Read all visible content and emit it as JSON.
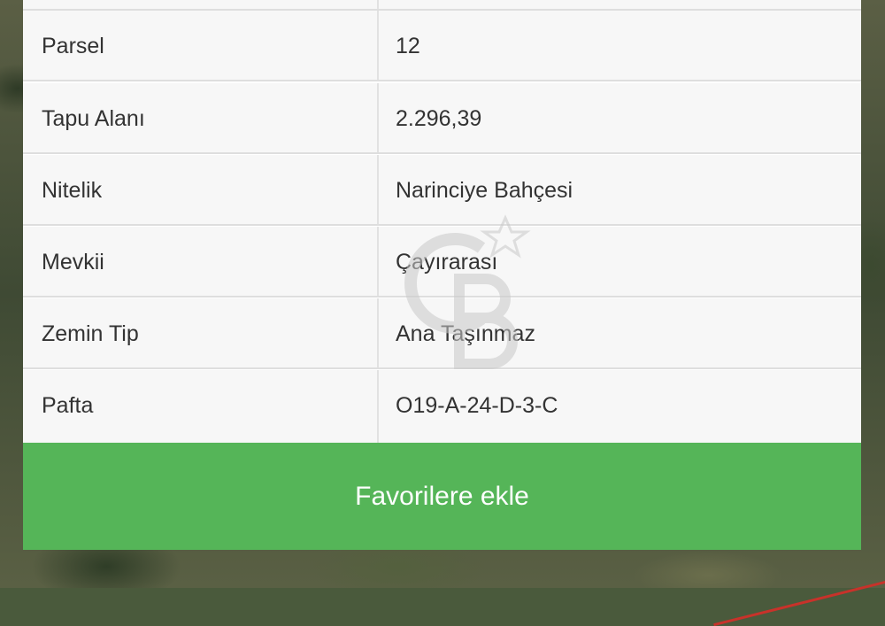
{
  "table": {
    "rows": [
      {
        "label": "",
        "value": ""
      },
      {
        "label": "Parsel",
        "value": "12"
      },
      {
        "label": "Tapu Alanı",
        "value": "2.296,39"
      },
      {
        "label": "Nitelik",
        "value": "Narinciye Bahçesi"
      },
      {
        "label": "Mevkii",
        "value": "Çayırarası"
      },
      {
        "label": "Zemin Tip",
        "value": "Ana Taşınmaz"
      },
      {
        "label": "Pafta",
        "value": "O19-A-24-D-3-C"
      }
    ]
  },
  "actions": {
    "favorite_label": "Favorilere ekle"
  },
  "colors": {
    "button_green": "#55b558",
    "row_background": "#f7f7f7",
    "text": "#333333"
  }
}
